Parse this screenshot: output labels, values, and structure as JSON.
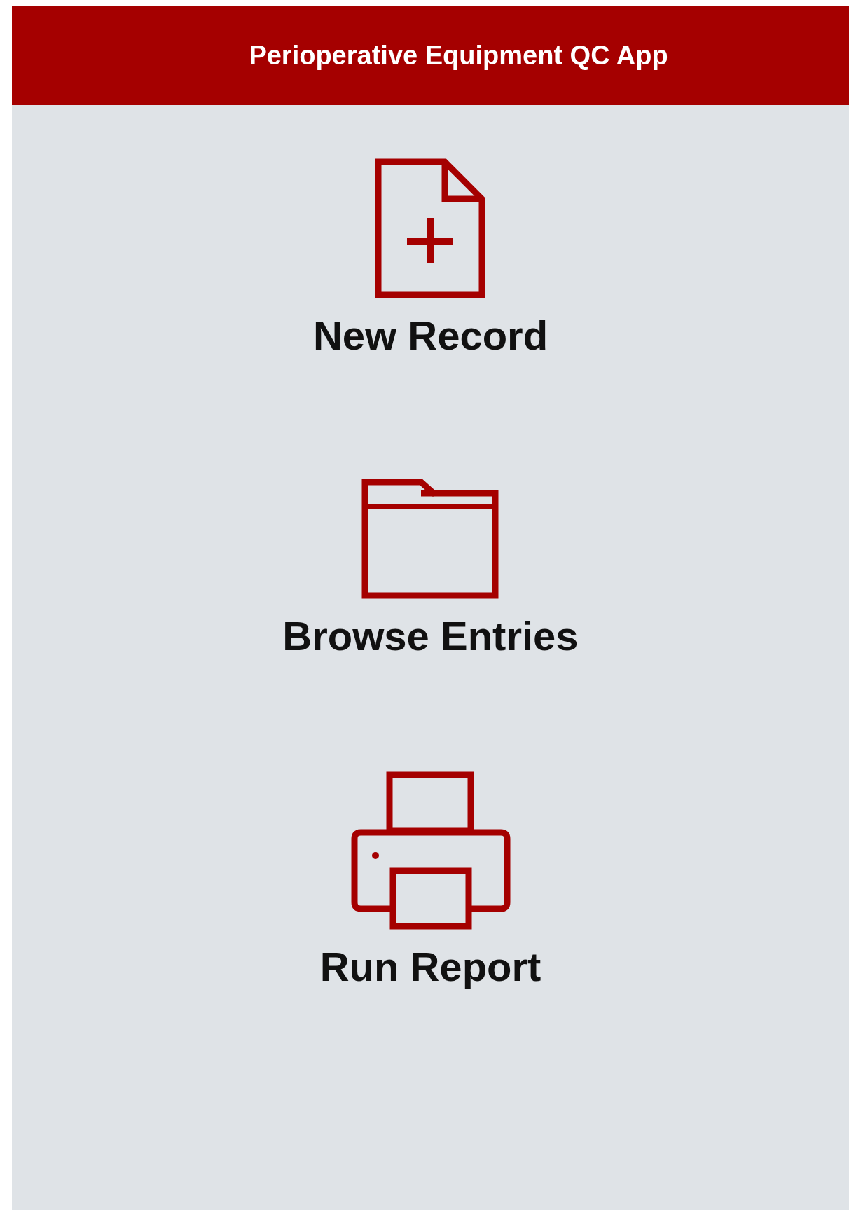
{
  "header": {
    "title": "Perioperative Equipment QC App"
  },
  "actions": [
    {
      "label": "New Record"
    },
    {
      "label": "Browse Entries"
    },
    {
      "label": "Run Report"
    }
  ]
}
